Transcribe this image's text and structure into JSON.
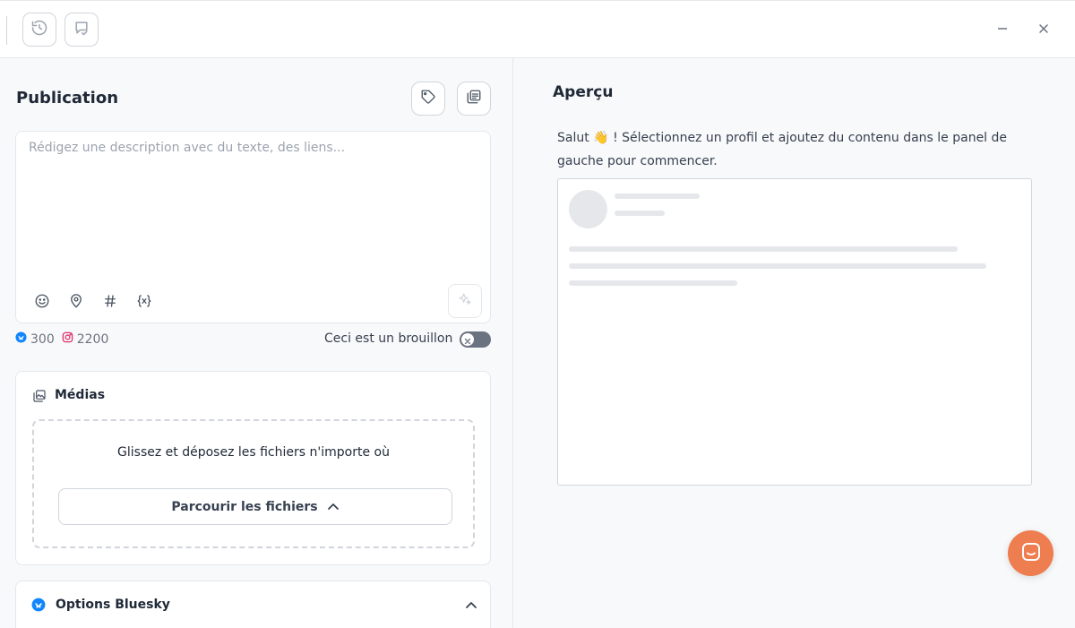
{
  "toolbar": {
    "history_icon": "history-icon",
    "comments_icon": "comment-check-icon",
    "minimize_icon": "minimize-icon",
    "close_icon": "close-icon"
  },
  "publication": {
    "title": "Publication",
    "tag_icon": "tag-icon",
    "templates_icon": "templates-icon",
    "editor": {
      "placeholder": "Rédigez une description avec du texte, des liens...",
      "value": "",
      "icons": [
        "emoji-icon",
        "location-icon",
        "hashtag-icon",
        "variable-icon"
      ],
      "ai_icon": "sparkles-icon"
    },
    "counts": [
      {
        "network": "bluesky",
        "value": "300",
        "color": "#1185fe"
      },
      {
        "network": "instagram",
        "value": "2200",
        "color": "#e1306c"
      }
    ],
    "draft_label": "Ceci est un brouillon",
    "draft_enabled": false
  },
  "medias": {
    "title": "Médias",
    "dropzone_text": "Glissez et déposez les fichiers n'importe où",
    "browse_label": "Parcourir les fichiers"
  },
  "bluesky_options": {
    "title": "Options Bluesky",
    "expanded": true
  },
  "preview": {
    "title": "Aperçu",
    "message_prefix": "Salut",
    "wave_emoji": "👋",
    "message_suffix": "! Sélectionnez un profil et ajoutez du contenu dans le panel de gauche pour commencer."
  },
  "colors": {
    "accent_chat": "#ee7d4f",
    "bluesky": "#1185fe",
    "instagram": "#e1306c"
  }
}
